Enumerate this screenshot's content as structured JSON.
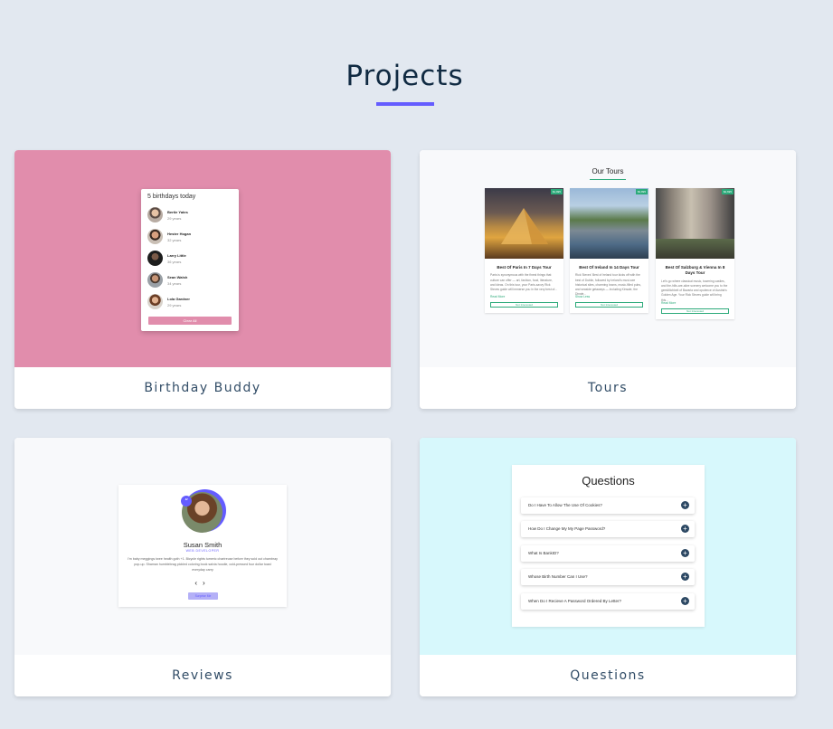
{
  "page": {
    "title": "Projects"
  },
  "projects": [
    {
      "label": "Birthday Buddy",
      "preview": {
        "heading": "5 birthdays today",
        "people": [
          {
            "name": "Bertie Yates",
            "age": "29 years"
          },
          {
            "name": "Hester Hogan",
            "age": "32 years"
          },
          {
            "name": "Larry Little",
            "age": "36 years"
          },
          {
            "name": "Sean Walsh",
            "age": "34 years"
          },
          {
            "name": "Lola Gardner",
            "age": "29 years"
          }
        ],
        "button": "Clear All"
      }
    },
    {
      "label": "Tours",
      "preview": {
        "heading": "Our Tours",
        "tours": [
          {
            "name": "Best Of Paris In 7 Days Tour",
            "price": "$1,995",
            "info": "Paris is synonymous with the finest things that culture can offer — art, fashion, food, literature, and ideas. On this tour, your Paris-savvy Rick Steves guide will immerse you in the very best of...",
            "more": "Read More",
            "button": "Not Interested"
          },
          {
            "name": "Best Of Ireland In 14 Days Tour",
            "price": "$3,895",
            "info": "Rick Steves' Best of Ireland tour kicks off with the best of Dublin, followed by Ireland's must-see historical sites, charming towns, music-filled pubs, and seaside getaways — including Kinsale, the Dingle...",
            "more": "Show Less",
            "button": "Not Interested"
          },
          {
            "name": "Best Of Salzburg & Vienna In 8 Days Tour",
            "price": "$2,695",
            "info": "Let's go where classical music, towering castles, and the-hills-are-alive scenery welcome you to the gemütlichkeit of Bavaria and opulence of Austria's Golden Age. Your Rick Steves guide will bring this...",
            "more": "Read More",
            "button": "Not Interested"
          }
        ]
      }
    },
    {
      "label": "Reviews",
      "preview": {
        "name": "Susan Smith",
        "job": "WEB DEVELOPER",
        "text": "I'm baby meggings twee health goth +1. Bicycle rights tumeric chartreuse before they sold out chambray pop-up. Shaman humblebrag pickled coloring book salvia hoodie, cold-pressed four dollar toast everyday carry",
        "prev": "‹",
        "next": "›",
        "quote": "“",
        "button": "Surprise Me"
      }
    },
    {
      "label": "Questions",
      "preview": {
        "heading": "Questions",
        "items": [
          "Do I Have To Allow The Use Of Cookies?",
          "How Do I Change My My Page Password?",
          "What Is BankID?",
          "Whose Birth Number Can I Use?",
          "When Do I Recieve A Password Ordered By Letter?"
        ],
        "toggle": "+"
      }
    }
  ],
  "colors": {
    "background": "#e2e8f0",
    "accent": "#645cff",
    "birthday": "#e18dac",
    "tours_green": "#2caa7a",
    "questions_bg": "#d7f8fc"
  }
}
